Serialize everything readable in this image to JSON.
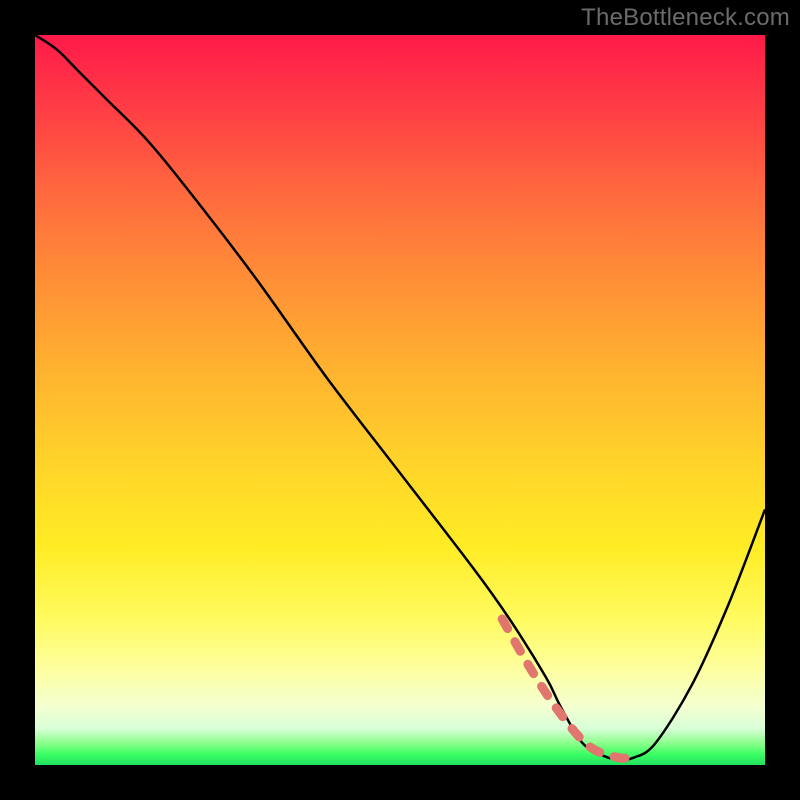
{
  "watermark": "TheBottleneck.com",
  "chart_data": {
    "type": "line",
    "title": "",
    "xlabel": "",
    "ylabel": "",
    "xlim": [
      0,
      100
    ],
    "ylim": [
      0,
      100
    ],
    "grid": false,
    "legend": false,
    "series": [
      {
        "name": "bottleneck-curve",
        "color": "#000000",
        "x": [
          0,
          3,
          6,
          10,
          15,
          20,
          30,
          40,
          50,
          60,
          65,
          70,
          72,
          75,
          78,
          80,
          82,
          85,
          90,
          95,
          100
        ],
        "values": [
          100,
          98,
          95,
          91,
          86,
          80,
          67,
          53,
          40,
          27,
          20,
          12,
          8,
          3,
          1.2,
          0.8,
          1.0,
          3,
          11,
          22,
          35
        ]
      },
      {
        "name": "optimal-range-marker",
        "color": "#e0766e",
        "style": "dashed",
        "x": [
          64,
          68,
          72,
          76,
          80,
          82
        ],
        "values": [
          20,
          13,
          7,
          2.5,
          1.0,
          1.2
        ]
      }
    ],
    "background_gradient": {
      "direction": "vertical",
      "stops": [
        {
          "pos": 0,
          "color": "#ff1a49"
        },
        {
          "pos": 22,
          "color": "#ff6a3e"
        },
        {
          "pos": 45,
          "color": "#ffb030"
        },
        {
          "pos": 70,
          "color": "#ffec24"
        },
        {
          "pos": 92,
          "color": "#f4ffd0"
        },
        {
          "pos": 100,
          "color": "#20e060"
        }
      ]
    }
  }
}
